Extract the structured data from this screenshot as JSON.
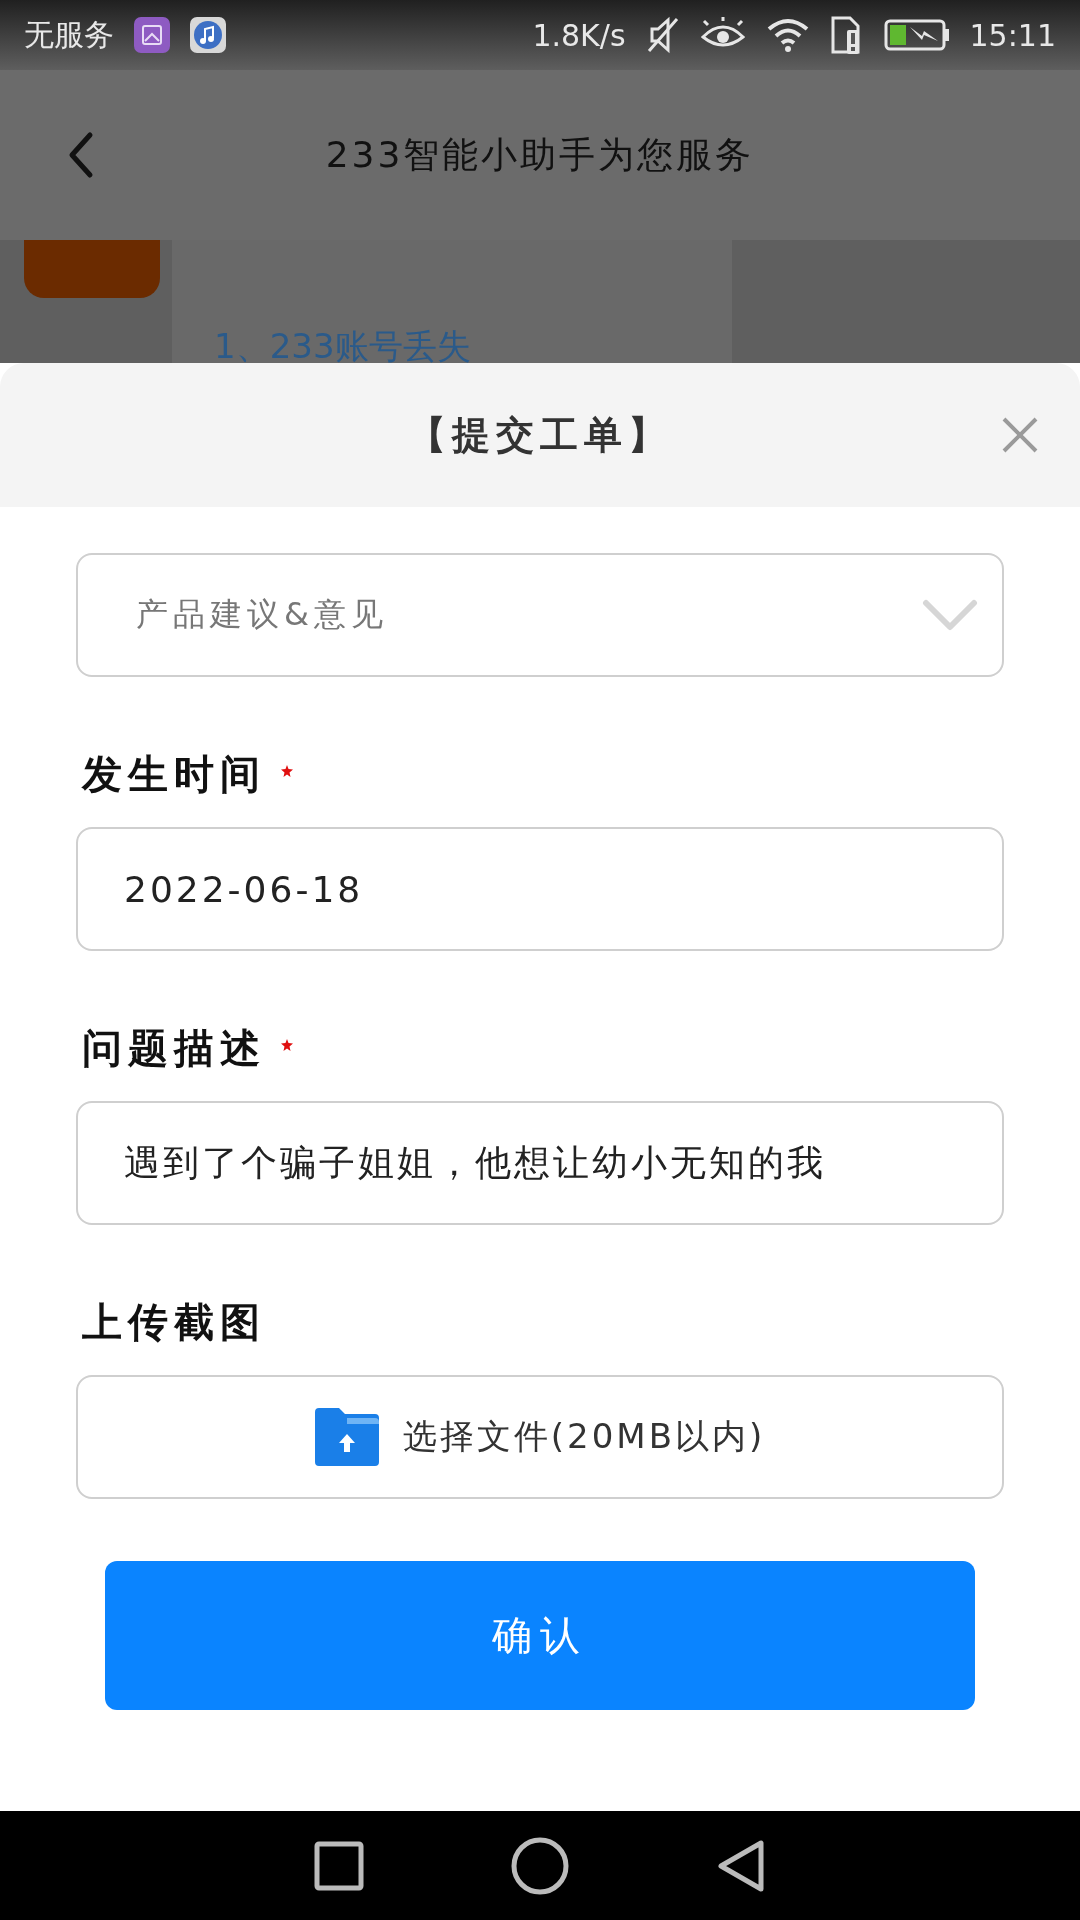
{
  "status_bar": {
    "carrier": "无服务",
    "speed": "1.8K/s",
    "time": "15:11"
  },
  "header": {
    "title": "233智能小助手为您服务"
  },
  "background": {
    "link": "1、233账号丢失"
  },
  "sheet": {
    "title": "【提交工单】",
    "fields": [
      {
        "kind": "select",
        "value": "产品建议&意见"
      },
      {
        "kind": "text",
        "label": "发生时间",
        "required": true,
        "value": "2022-06-18"
      },
      {
        "kind": "text",
        "label": "问题描述",
        "required": true,
        "value": "遇到了个骗子姐姐，他想让幼小无知的我"
      },
      {
        "kind": "upload",
        "label": "上传截图",
        "required": false,
        "button": "选择文件(20MB以内)"
      }
    ],
    "confirm": "确认"
  }
}
